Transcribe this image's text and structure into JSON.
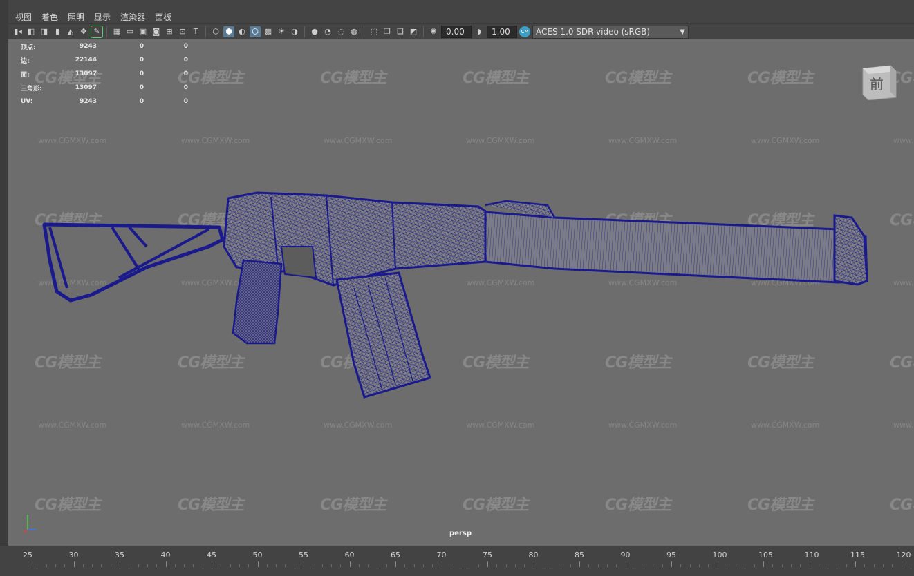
{
  "menu": [
    "视图",
    "着色",
    "照明",
    "显示",
    "渲染器",
    "面板"
  ],
  "toolbar": {
    "exposure": "0.00",
    "gamma": "1.00",
    "color_space": "ACES 1.0 SDR-video (sRGB)"
  },
  "hud": {
    "rows": [
      {
        "label": "顶点:",
        "v1": "9243",
        "v2": "0",
        "v3": "0"
      },
      {
        "label": "边:",
        "v1": "22144",
        "v2": "0",
        "v3": "0"
      },
      {
        "label": "面:",
        "v1": "13097",
        "v2": "0",
        "v3": "0"
      },
      {
        "label": "三角形:",
        "v1": "13097",
        "v2": "0",
        "v3": "0"
      },
      {
        "label": "UV:",
        "v1": "9243",
        "v2": "0",
        "v3": "0"
      }
    ]
  },
  "viewcube_label": "前",
  "camera_label": "persp",
  "watermark": {
    "logo": "CG模型主",
    "url": "www.CGMXW.com"
  },
  "timeline": {
    "ticks": [
      "25",
      "30",
      "35",
      "40",
      "45",
      "50",
      "55",
      "60",
      "65",
      "70",
      "75",
      "80",
      "85",
      "90",
      "95",
      "100",
      "105",
      "110",
      "115",
      "120"
    ]
  },
  "colors": {
    "wireframe": "#1a1a8c",
    "mesh_fill": "#808080",
    "viewport_bg": "#6d6d6d"
  }
}
